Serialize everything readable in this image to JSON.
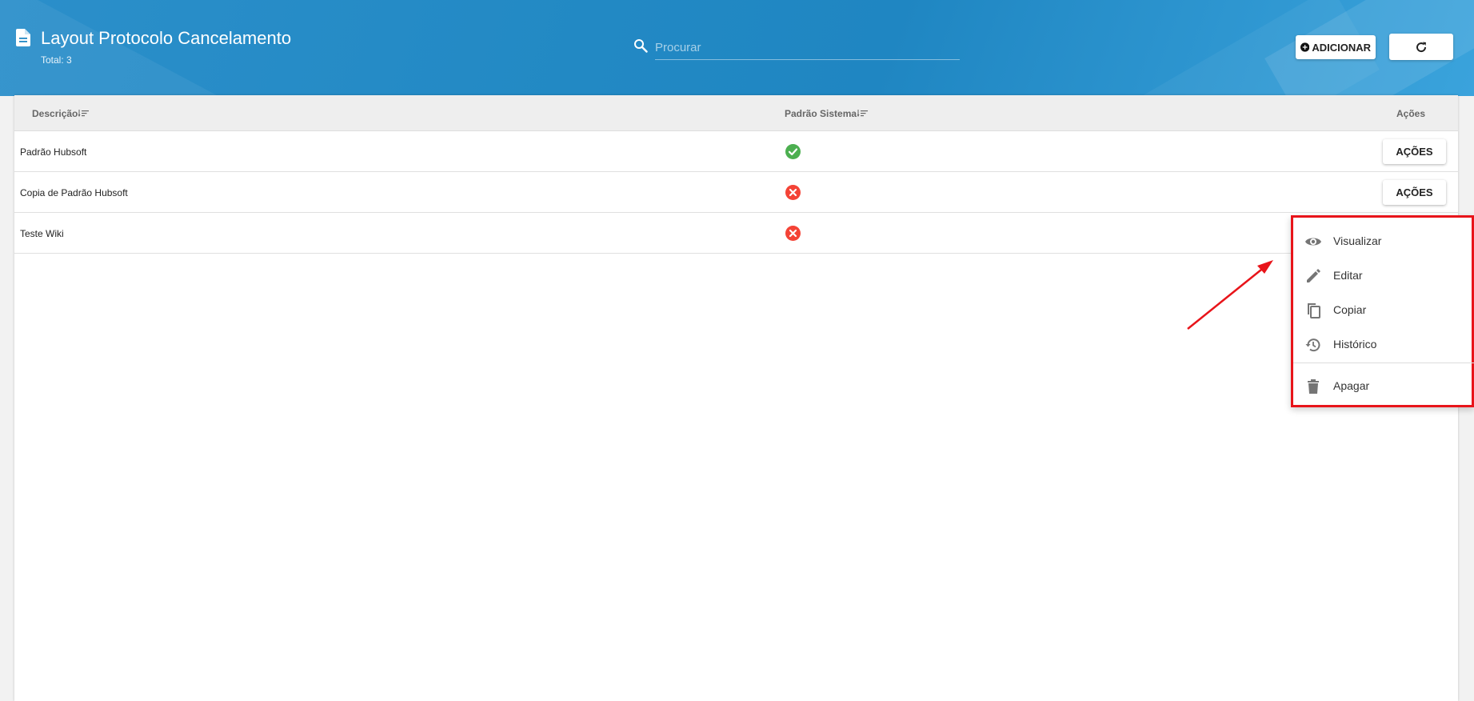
{
  "header": {
    "title": "Layout Protocolo Cancelamento",
    "total": "Total: 3",
    "title_icon": "document-icon",
    "search": {
      "placeholder": "Procurar",
      "icon": "search-icon"
    },
    "add_button": {
      "label": "ADICIONAR",
      "icon": "add-circle-icon"
    },
    "refresh_button": {
      "icon": "refresh-icon"
    }
  },
  "table": {
    "columns": [
      {
        "label": "Descrição",
        "sortable": true
      },
      {
        "label": "Padrão Sistema",
        "sortable": true
      },
      {
        "label": "Ações",
        "sortable": false
      }
    ],
    "rows": [
      {
        "descricao": "Padrão Hubsoft",
        "padrao_sistema": true,
        "acoes_label": "AÇÕES"
      },
      {
        "descricao": "Copia de Padrão Hubsoft",
        "padrao_sistema": false,
        "acoes_label": "AÇÕES"
      },
      {
        "descricao": "Teste Wiki",
        "padrao_sistema": false,
        "acoes_label": ""
      }
    ]
  },
  "actions_menu": {
    "items": [
      {
        "label": "Visualizar",
        "icon": "eye-icon"
      },
      {
        "label": "Editar",
        "icon": "pencil-icon"
      },
      {
        "label": "Copiar",
        "icon": "copy-icon"
      },
      {
        "label": "Histórico",
        "icon": "history-icon"
      },
      {
        "label": "Apagar",
        "icon": "trash-icon"
      }
    ]
  },
  "colors": {
    "header_blue": "#2289c4",
    "status_ok": "#4caf50",
    "status_no": "#f44336",
    "highlight_red": "#e8141a"
  }
}
